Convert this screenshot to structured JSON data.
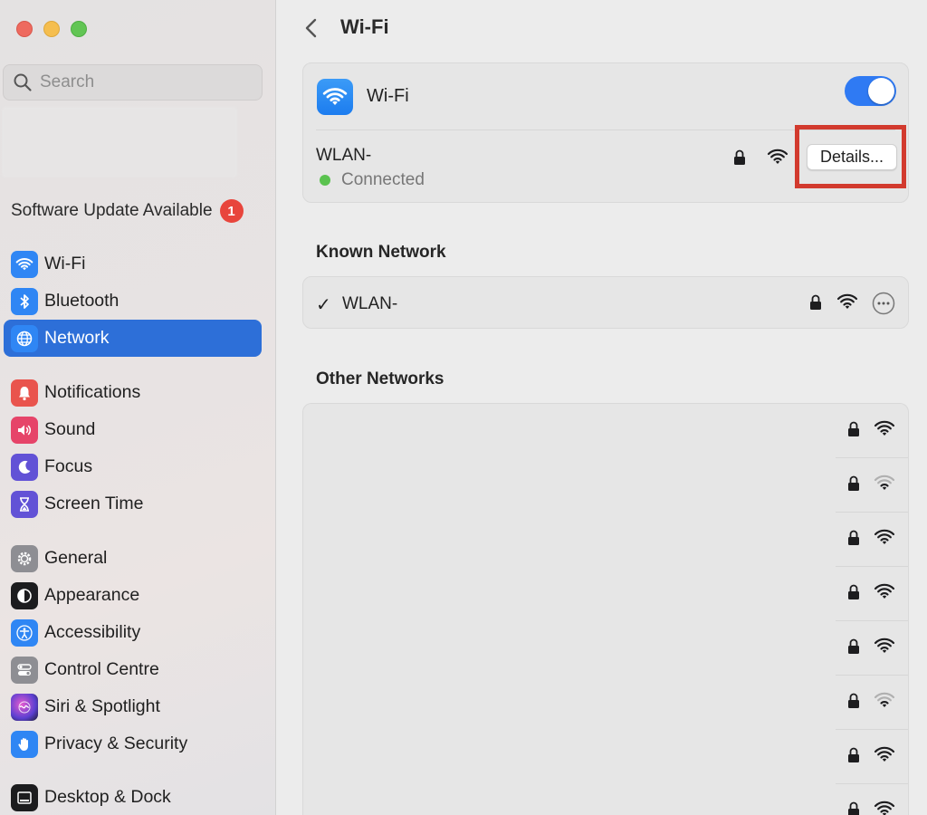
{
  "window": {
    "title": "Wi-Fi"
  },
  "search": {
    "placeholder": "Search"
  },
  "sidebar": {
    "update_label": "Software Update Available",
    "update_badge": "1",
    "items": [
      {
        "label": "Wi-Fi",
        "icon": "wifi-icon",
        "color": "#2f86f4"
      },
      {
        "label": "Bluetooth",
        "icon": "bluetooth-icon",
        "color": "#2f86f4"
      },
      {
        "label": "Network",
        "icon": "globe-icon",
        "color": "#2f86f4",
        "selected": true
      },
      {
        "label": "Notifications",
        "icon": "bell-icon",
        "color": "#e9544d"
      },
      {
        "label": "Sound",
        "icon": "speaker-icon",
        "color": "#e64469"
      },
      {
        "label": "Focus",
        "icon": "moon-icon",
        "color": "#6252d6"
      },
      {
        "label": "Screen Time",
        "icon": "hourglass-icon",
        "color": "#6252d6"
      },
      {
        "label": "General",
        "icon": "gear-icon",
        "color": "#8e8e93"
      },
      {
        "label": "Appearance",
        "icon": "appearance-icon",
        "color": "#1c1c1e"
      },
      {
        "label": "Accessibility",
        "icon": "accessibility-icon",
        "color": "#2f86f4"
      },
      {
        "label": "Control Centre",
        "icon": "control-centre-icon",
        "color": "#8e8e93"
      },
      {
        "label": "Siri & Spotlight",
        "icon": "siri-icon",
        "color": "#5b3fd1"
      },
      {
        "label": "Privacy & Security",
        "icon": "hand-icon",
        "color": "#2f86f4"
      },
      {
        "label": "Desktop & Dock",
        "icon": "dock-icon",
        "color": "#1c1c1e"
      }
    ]
  },
  "main": {
    "title": "Wi-Fi",
    "wifi_label": "Wi-Fi",
    "wifi_enabled": true,
    "current_network": {
      "name": "WLAN-",
      "status": "Connected",
      "details_label": "Details..."
    },
    "known_title": "Known Network",
    "known_networks": [
      {
        "name": "WLAN-",
        "check": "✓"
      }
    ],
    "other_title": "Other Networks",
    "other_networks": [
      {
        "signal": "full"
      },
      {
        "signal": "weak"
      },
      {
        "signal": "full"
      },
      {
        "signal": "full"
      },
      {
        "signal": "full"
      },
      {
        "signal": "weak"
      },
      {
        "signal": "full"
      },
      {
        "signal": "full"
      }
    ]
  }
}
